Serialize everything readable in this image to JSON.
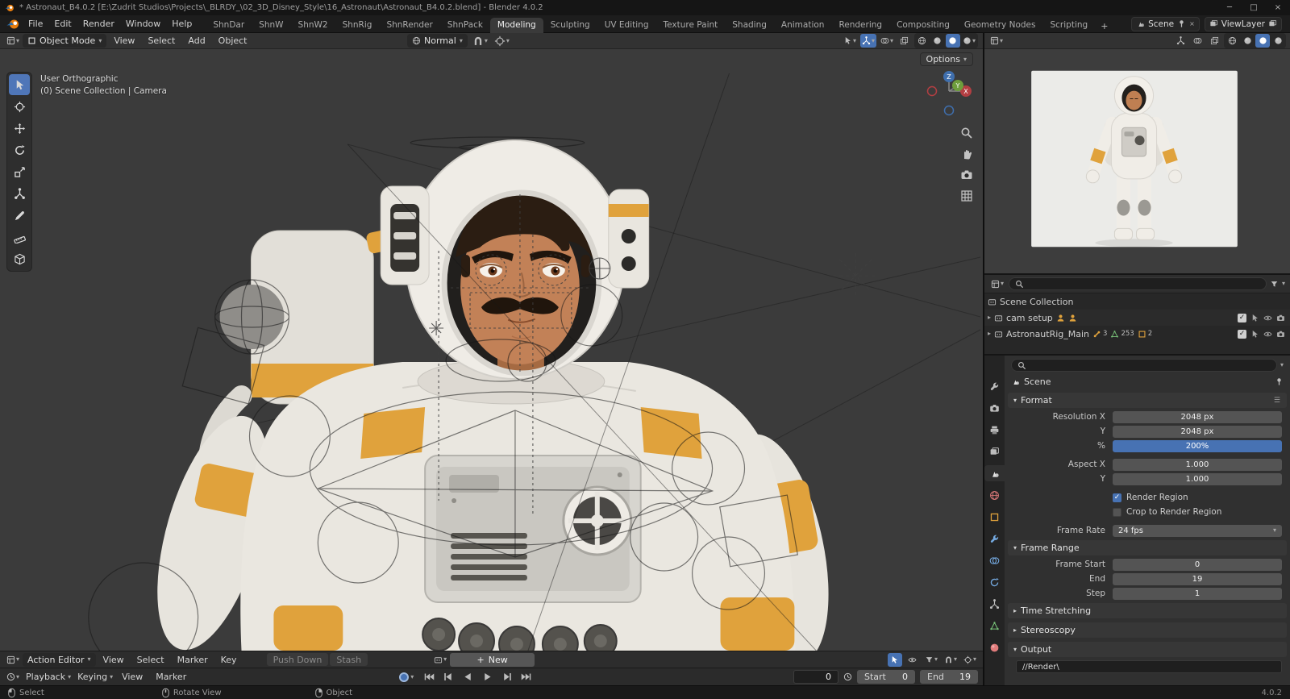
{
  "colors": {
    "accent": "#4772b3",
    "blender_orange": "#e87d0d",
    "suit_orange": "#e0a23c"
  },
  "icons": {
    "dropdown": "▾",
    "expand": "▸",
    "plus": "+",
    "close": "×",
    "minimize": "─",
    "maximize": "□",
    "check": "✓"
  },
  "titlebar": {
    "title": "* Astronaut_B4.0.2 [E:\\Zudrit Studios\\Projects\\_BLRDY_\\02_3D_Disney_Style\\16_Astronaut\\Astronaut_B4.0.2.blend] - Blender 4.0.2"
  },
  "topbar": {
    "menus": [
      "File",
      "Edit",
      "Render",
      "Window",
      "Help"
    ],
    "workspaces": [
      "ShnDar",
      "ShnW",
      "ShnW2",
      "ShnRig",
      "ShnRender",
      "ShnPack",
      "Modeling",
      "Sculpting",
      "UV Editing",
      "Texture Paint",
      "Shading",
      "Animation",
      "Rendering",
      "Compositing",
      "Geometry Nodes",
      "Scripting"
    ],
    "scene_name": "Scene",
    "viewlayer_name": "ViewLayer"
  },
  "viewport_header": {
    "mode": "Object Mode",
    "menus": [
      "View",
      "Select",
      "Add",
      "Object"
    ],
    "orientation": "Normal"
  },
  "viewport": {
    "options_label": "Options",
    "overlay_line1": "User Orthographic",
    "overlay_line2": "(0) Scene Collection | Camera",
    "gizmo": {
      "x": "X",
      "y": "Y",
      "z": "Z"
    }
  },
  "outliner": {
    "rows": [
      {
        "label": "Scene Collection"
      },
      {
        "label": "cam setup"
      },
      {
        "label": "AstronautRig_Main",
        "badge1": "3",
        "badge2": "253",
        "badge3": "2"
      }
    ]
  },
  "properties": {
    "breadcrumb": "Scene",
    "format": {
      "title": "Format",
      "rows": [
        {
          "label": "Resolution X",
          "value": "2048 px"
        },
        {
          "label": "Y",
          "value": "2048 px"
        },
        {
          "label": "%",
          "value": "200%"
        },
        {
          "label": "Aspect X",
          "value": "1.000"
        },
        {
          "label": "Y",
          "value": "1.000"
        }
      ],
      "render_region": "Render Region",
      "crop_to_render_region": "Crop to Render Region",
      "frame_rate_label": "Frame Rate",
      "frame_rate_value": "24 fps"
    },
    "frame_range": {
      "title": "Frame Range",
      "rows": [
        {
          "label": "Frame Start",
          "value": "0"
        },
        {
          "label": "End",
          "value": "19"
        },
        {
          "label": "Step",
          "value": "1"
        }
      ]
    },
    "time_stretching_title": "Time Stretching",
    "stereoscopy_title": "Stereoscopy",
    "output": {
      "title": "Output",
      "path": "//Render\\"
    }
  },
  "dopesheet": {
    "editor": "Action Editor",
    "menus": [
      "View",
      "Select",
      "Marker",
      "Key"
    ],
    "push_down": "Push Down",
    "stash": "Stash",
    "new_label": "New"
  },
  "timeline": {
    "playback": "Playback",
    "keying": "Keying",
    "view": "View",
    "marker": "Marker",
    "current_frame": "0",
    "start_label": "Start",
    "start_value": "0",
    "end_label": "End",
    "end_value": "19"
  },
  "statusbar": {
    "select": "Select",
    "rotate_view": "Rotate View",
    "object": "Object",
    "version": "4.0.2"
  }
}
